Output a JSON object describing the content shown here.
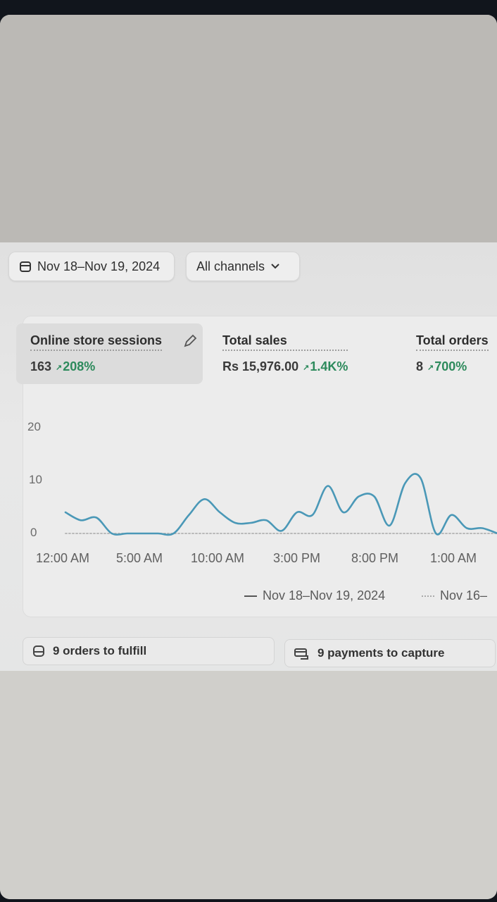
{
  "filters": {
    "date_range": "Nov 18–Nov 19, 2024",
    "channel": "All channels"
  },
  "metrics": [
    {
      "label": "Online store sessions",
      "value": "163",
      "change": "208%"
    },
    {
      "label": "Total sales",
      "value": "Rs 15,976.00",
      "change": "1.4K%"
    },
    {
      "label": "Total orders",
      "value": "8",
      "change": "700%"
    }
  ],
  "chart_data": {
    "type": "line",
    "y_ticks": [
      "20",
      "10",
      "0"
    ],
    "x_ticks": [
      "12:00 AM",
      "5:00 AM",
      "10:00 AM",
      "3:00 PM",
      "8:00 PM",
      "1:00 AM"
    ],
    "ylim": [
      0,
      20
    ],
    "series": [
      {
        "name": "Nov 18–Nov 19, 2024",
        "style": "solid",
        "color": "#4a98b7",
        "values": [
          4,
          2.5,
          3,
          0,
          0,
          0,
          0,
          0,
          3.5,
          6.5,
          4,
          2,
          2,
          2.5,
          0.5,
          4,
          3.5,
          9,
          4,
          7,
          7,
          1.5,
          9.5,
          10.5,
          0,
          3.5,
          1,
          1,
          0
        ]
      },
      {
        "name": "Nov 16–",
        "style": "dotted",
        "color": "#b9b9b9",
        "values": [
          0,
          0,
          0,
          0,
          0,
          0,
          0,
          0,
          0,
          0,
          0,
          0,
          0,
          0,
          0,
          0,
          0,
          0,
          0,
          0,
          0,
          0,
          0,
          0,
          0,
          0,
          0,
          0,
          0
        ]
      }
    ]
  },
  "legend": {
    "current": "Nov 18–Nov 19, 2024",
    "previous": "Nov 16–"
  },
  "tasks": [
    {
      "label": "9 orders to fulfill",
      "icon": "inbox-icon"
    },
    {
      "label": "9 payments to capture",
      "icon": "payment-icon"
    }
  ],
  "colors": {
    "positive": "#2d8a5c",
    "line": "#4a98b7"
  }
}
